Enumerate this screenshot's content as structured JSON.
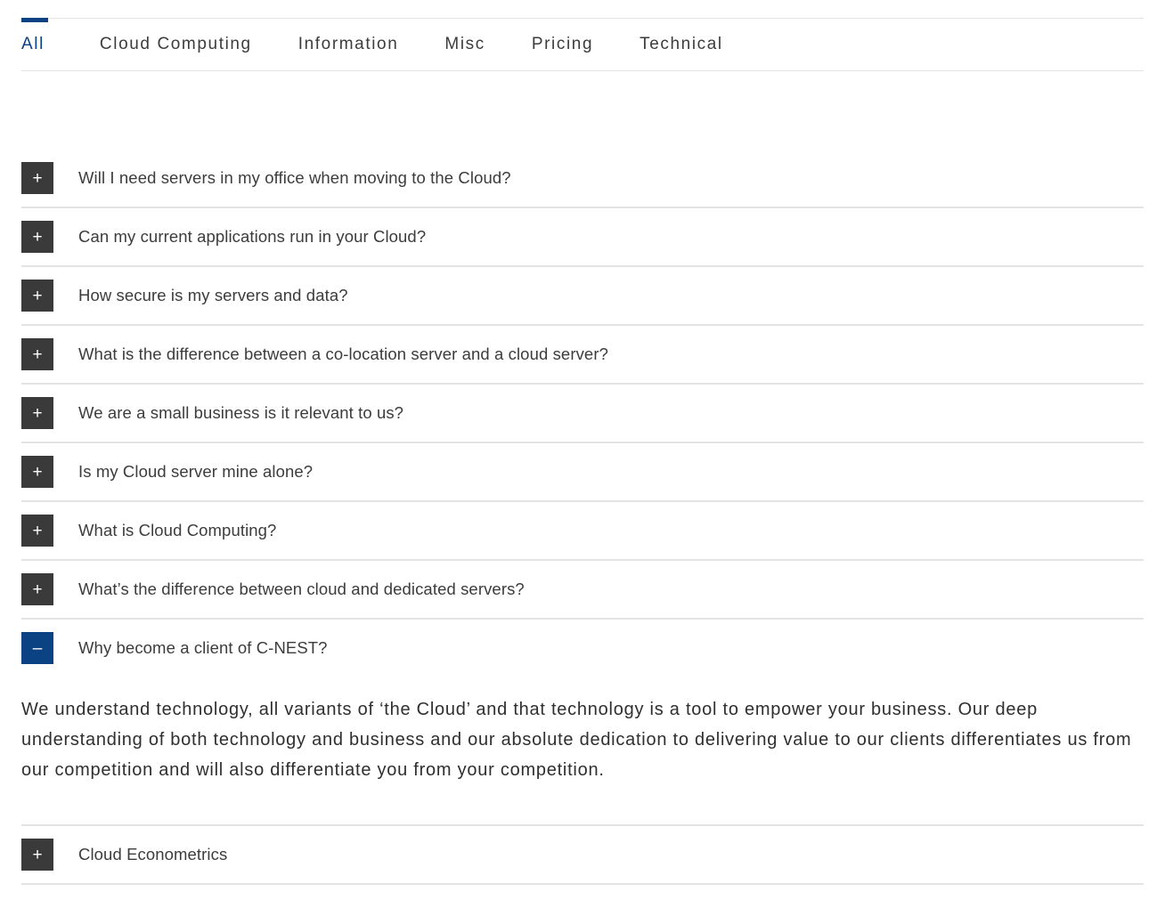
{
  "tabs": [
    {
      "label": "All",
      "active": true
    },
    {
      "label": "Cloud Computing",
      "active": false
    },
    {
      "label": "Information",
      "active": false
    },
    {
      "label": "Misc",
      "active": false
    },
    {
      "label": "Pricing",
      "active": false
    },
    {
      "label": "Technical",
      "active": false
    }
  ],
  "icons": {
    "plus": "+",
    "minus": "–"
  },
  "colors": {
    "accent_blue": "#0b4284",
    "toggle_dark": "#3a3a3a",
    "rule": "#e4e4e4",
    "text": "#3c3c3c"
  },
  "faq": [
    {
      "question": "Will I need servers in my office when moving to the Cloud?",
      "open": false,
      "answer": ""
    },
    {
      "question": "Can my current applications run in your Cloud?",
      "open": false,
      "answer": ""
    },
    {
      "question": "How secure is my servers and data?",
      "open": false,
      "answer": ""
    },
    {
      "question": "What is the difference between a co-location server and a cloud server?",
      "open": false,
      "answer": ""
    },
    {
      "question": "We are a small business is it relevant to us?",
      "open": false,
      "answer": ""
    },
    {
      "question": "Is my Cloud server mine alone?",
      "open": false,
      "answer": ""
    },
    {
      "question": "What is Cloud Computing?",
      "open": false,
      "answer": ""
    },
    {
      "question": "What’s the difference between cloud and dedicated servers?",
      "open": false,
      "answer": ""
    },
    {
      "question": "Why become a client of C-NEST?",
      "open": true,
      "answer": "We understand technology, all variants of ‘the Cloud’  and that technology is a tool to empower your business. Our deep understanding of both technology and business and our absolute dedication to delivering value to our clients differentiates us from our competition and will also differentiate you from your competition."
    },
    {
      "question": "Cloud Econometrics",
      "open": false,
      "answer": ""
    }
  ]
}
